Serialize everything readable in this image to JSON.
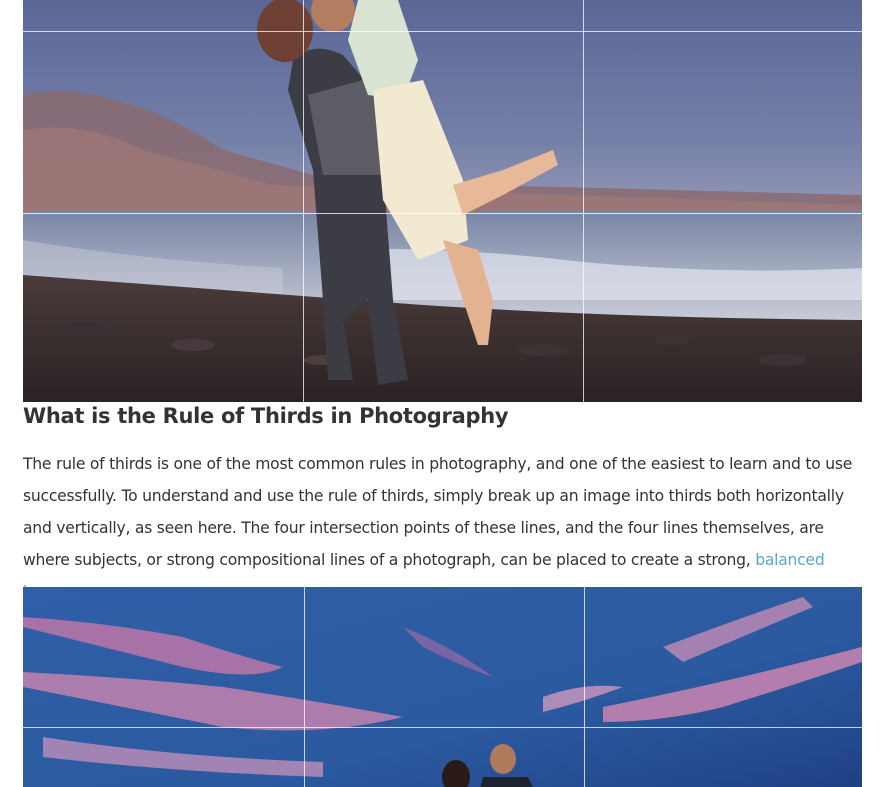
{
  "article": {
    "heading": "What is the Rule of Thirds in Photography",
    "paragraph_before_link": "The rule of thirds is one of the most common rules in photography, and one of the easiest to learn and to use successfully. To understand and use the rule of thirds, simply break up an image into thirds both horizontally and vertically, as seen here. The four intersection points of these lines, and the four lines themselves, are where subjects, or strong compositional lines of a photograph, can be placed to create a strong,",
    "link_text": "balanced image",
    "paragraph_after_link": "."
  },
  "colors": {
    "link": "#5aa7c9",
    "text": "#333333",
    "grid_line": "#ffffff"
  }
}
